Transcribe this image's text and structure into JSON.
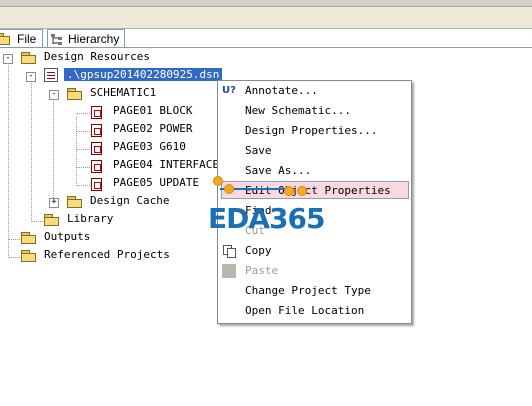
{
  "tabs": [
    {
      "label": "File",
      "icon": "folder-icon"
    },
    {
      "label": "Hierarchy",
      "icon": "hierarchy-icon"
    }
  ],
  "tree": {
    "design_resources": "Design Resources",
    "dsn_file": ".\\gpsup201402280925.dsn",
    "schematic": "SCHEMATIC1",
    "pages": [
      "PAGE01 BLOCK",
      "PAGE02 POWER",
      "PAGE03 G610",
      "PAGE04 INTERFACE",
      "PAGE05 UPDATE"
    ],
    "design_cache": "Design Cache",
    "library": "Library",
    "outputs": "Outputs",
    "referenced_projects": "Referenced Projects",
    "expander_minus": "-",
    "expander_plus": "+"
  },
  "context_menu": {
    "items": [
      {
        "label": "Annotate...",
        "icon": "U?",
        "enabled": true
      },
      {
        "label": "New Schematic...",
        "enabled": true
      },
      {
        "label": "Design Properties...",
        "enabled": true
      },
      {
        "label": "Save",
        "enabled": true
      },
      {
        "label": "Save As...",
        "enabled": true
      },
      {
        "label": "Edit Object Properties",
        "enabled": true,
        "highlighted": true
      },
      {
        "label": "Find",
        "enabled": true
      },
      {
        "label": "Cut",
        "enabled": false
      },
      {
        "label": "Copy",
        "enabled": true
      },
      {
        "label": "Paste",
        "enabled": false
      },
      {
        "label": "Change Project Type",
        "enabled": true
      },
      {
        "label": "Open File Location",
        "enabled": true
      }
    ]
  },
  "watermark": {
    "text": "EDA365"
  },
  "colors": {
    "selection": "#316ac5",
    "highlight": "#f9d8df",
    "watermark": "#1b6fb5",
    "accent_dot": "#f5a623"
  }
}
